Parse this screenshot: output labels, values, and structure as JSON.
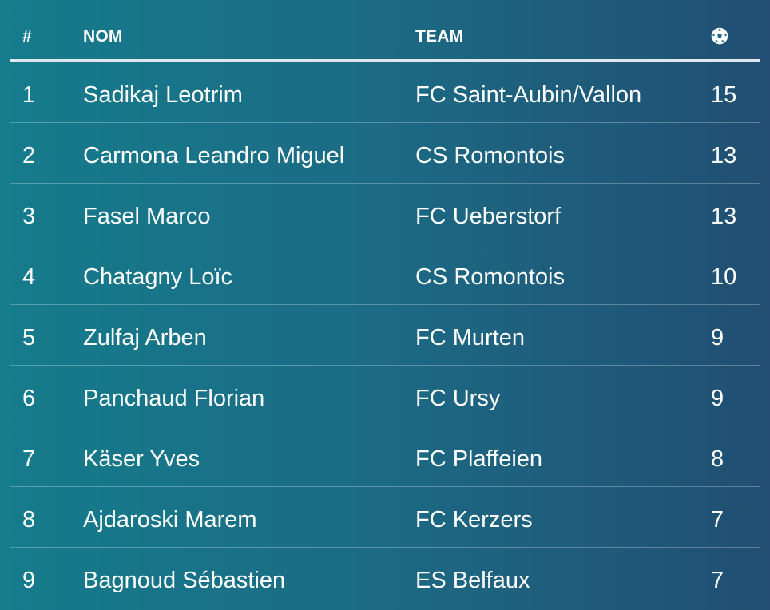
{
  "header": {
    "rank": "#",
    "name": "NOM",
    "team": "TEAM",
    "goals_icon": "soccer-ball-icon"
  },
  "rows": [
    {
      "rank": "1",
      "name": "Sadikaj Leotrim",
      "team": "FC Saint-Aubin/Vallon",
      "goals": "15"
    },
    {
      "rank": "2",
      "name": "Carmona Leandro Miguel",
      "team": "CS Romontois",
      "goals": "13"
    },
    {
      "rank": "3",
      "name": "Fasel Marco",
      "team": "FC Ueberstorf",
      "goals": "13"
    },
    {
      "rank": "4",
      "name": "Chatagny Loïc",
      "team": "CS Romontois",
      "goals": "10"
    },
    {
      "rank": "5",
      "name": "Zulfaj Arben",
      "team": "FC Murten",
      "goals": "9"
    },
    {
      "rank": "6",
      "name": "Panchaud Florian",
      "team": "FC Ursy",
      "goals": "9"
    },
    {
      "rank": "7",
      "name": "Käser Yves",
      "team": "FC Plaffeien",
      "goals": "8"
    },
    {
      "rank": "8",
      "name": "Ajdaroski Marem",
      "team": "FC Kerzers",
      "goals": "7"
    },
    {
      "rank": "9",
      "name": "Bagnoud Sébastien",
      "team": "ES Belfaux",
      "goals": "7"
    }
  ],
  "colors": {
    "background_start": "#157c8c",
    "background_end": "#214e72",
    "text": "#ffffff",
    "header_rule": "#dfe7ec"
  }
}
